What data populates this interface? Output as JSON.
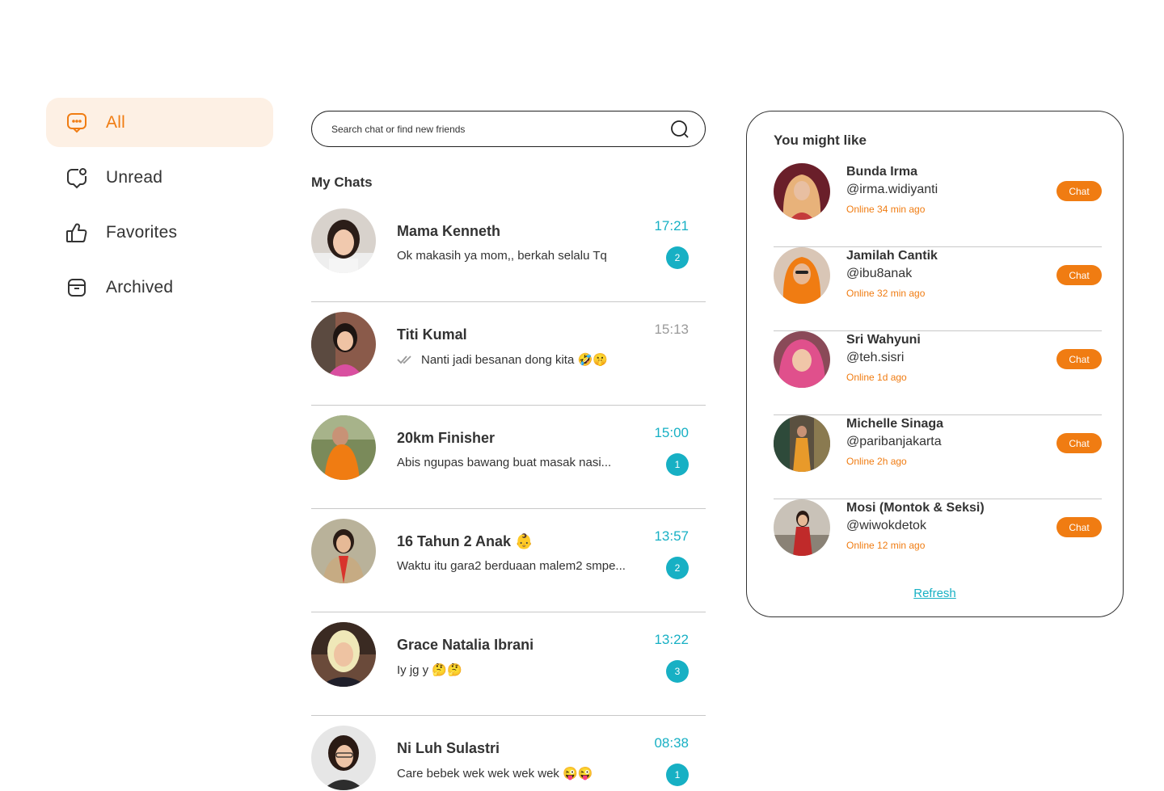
{
  "sidebar": {
    "items": [
      {
        "label": "All",
        "icon": "chat-bubble-icon",
        "active": true
      },
      {
        "label": "Unread",
        "icon": "unread-bubble-icon",
        "active": false
      },
      {
        "label": "Favorites",
        "icon": "thumbs-up-icon",
        "active": false
      },
      {
        "label": "Archived",
        "icon": "archive-box-icon",
        "active": false
      }
    ]
  },
  "search": {
    "placeholder": "Search chat or find new friends",
    "value": ""
  },
  "chats": {
    "title": "My Chats",
    "items": [
      {
        "name": "Mama Kenneth",
        "preview": "Ok makasih ya mom,, berkah selalu Tq",
        "time": "17:21",
        "unread": "2",
        "read": false
      },
      {
        "name": "Titi Kumal",
        "preview": "Nanti jadi besanan dong kita 🤣🤫",
        "time": "15:13",
        "unread": "",
        "read": true
      },
      {
        "name": "20km Finisher",
        "preview": "Abis ngupas bawang buat masak nasi...",
        "time": "15:00",
        "unread": "1",
        "read": false
      },
      {
        "name": "16 Tahun 2 Anak 👶",
        "preview": "Waktu itu gara2 berduaan malem2 smpe...",
        "time": "13:57",
        "unread": "2",
        "read": false
      },
      {
        "name": "Grace Natalia Ibrani",
        "preview": "Iy jg y 🤔🤔",
        "time": "13:22",
        "unread": "3",
        "read": false
      },
      {
        "name": "Ni Luh Sulastri",
        "preview": "Care bebek wek wek wek wek 😜😜",
        "time": "08:38",
        "unread": "1",
        "read": false
      }
    ]
  },
  "suggestions": {
    "title": "You might like",
    "items": [
      {
        "name": "Bunda Irma",
        "handle": "@irma.widiyanti",
        "status": "Online 34 min ago",
        "button": "Chat"
      },
      {
        "name": "Jamilah Cantik",
        "handle": "@ibu8anak",
        "status": "Online 32 min ago",
        "button": "Chat"
      },
      {
        "name": "Sri Wahyuni",
        "handle": "@teh.sisri",
        "status": "Online 1d ago",
        "button": "Chat"
      },
      {
        "name": "Michelle Sinaga",
        "handle": "@paribanjakarta",
        "status": "Online 2h ago",
        "button": "Chat"
      },
      {
        "name": "Mosi (Montok & Seksi)",
        "handle": "@wiwokdetok",
        "status": "Online 12 min ago",
        "button": "Chat"
      }
    ],
    "refresh": "Refresh"
  },
  "colors": {
    "accent": "#f07c12",
    "accent_bg": "#fdf0e4",
    "teal": "#17b0c4",
    "text": "#333333",
    "divider": "#c8c8c8"
  }
}
